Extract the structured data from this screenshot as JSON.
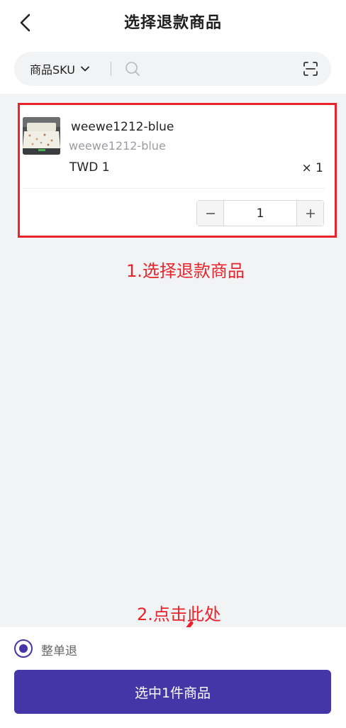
{
  "header": {
    "title": "选择退款商品"
  },
  "search": {
    "filter_label": "商品SKU",
    "placeholder": ""
  },
  "product": {
    "name": "weewe1212-blue",
    "sku": "weewe1212-blue",
    "price": "TWD 1",
    "quantity": "× 1",
    "selected_qty": "1"
  },
  "annotations": {
    "step1": "1.选择退款商品",
    "step2": "2.点击此处"
  },
  "footer": {
    "radio_label": "整单退",
    "cta_label": "选中1件商品"
  },
  "colors": {
    "accent": "#4536a8",
    "annotation": "#e8232a",
    "background": "#f2f3f5"
  }
}
